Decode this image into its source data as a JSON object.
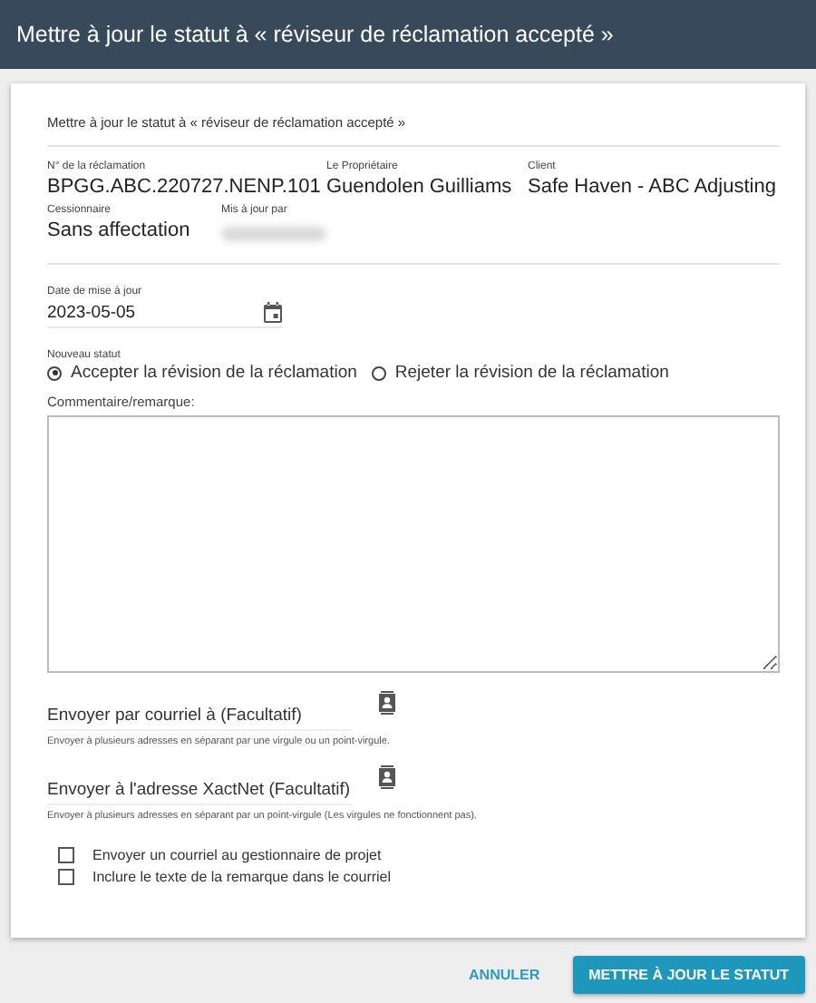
{
  "window": {
    "title": "Mettre à jour le statut à « réviseur de réclamation accepté »"
  },
  "subtitle": "Mettre à jour le statut à « réviseur de réclamation accepté »",
  "info_rows": [
    [
      {
        "label": "N° de la réclamation",
        "value": "BPGG.ABC.220727.NENP.101"
      },
      {
        "label": "Le Propriétaire",
        "value": "Guendolen Guilliams"
      },
      {
        "label": "Client",
        "value": "Safe Haven - ABC Adjusting"
      }
    ],
    [
      {
        "label": "Cessionnaire",
        "value": "Sans affectation"
      },
      {
        "label": "Mis à jour par",
        "redacted": true
      }
    ]
  ],
  "date_field": {
    "label": "Date de mise à jour",
    "value": "2023-05-05"
  },
  "status": {
    "label": "Nouveau statut",
    "options": [
      {
        "label": "Accepter la révision de la réclamation",
        "selected": true
      },
      {
        "label": "Rejeter la révision de la réclamation",
        "selected": false
      }
    ]
  },
  "comment": {
    "label": "Commentaire/remarque:"
  },
  "email_fields": [
    {
      "placeholder": "Envoyer par courriel à (Facultatif)",
      "hint": "Envoyer à plusieurs adresses en séparant par une virgule ou un point-virgule."
    },
    {
      "placeholder": "Envoyer à l'adresse XactNet (Facultatif)",
      "hint": "Envoyer à plusieurs adresses en séparant par un point-virgule (Les virgules ne fonctionnent pas)."
    }
  ],
  "checkboxes": [
    {
      "label": "Envoyer un courriel au gestionnaire de projet",
      "checked": false
    },
    {
      "label": "Inclure le texte de la remarque dans le courriel",
      "checked": false
    }
  ],
  "buttons": [
    {
      "label": "ANNULER",
      "kind": "text"
    },
    {
      "label": "METTRE À JOUR LE STATUT",
      "kind": "primary"
    }
  ]
}
